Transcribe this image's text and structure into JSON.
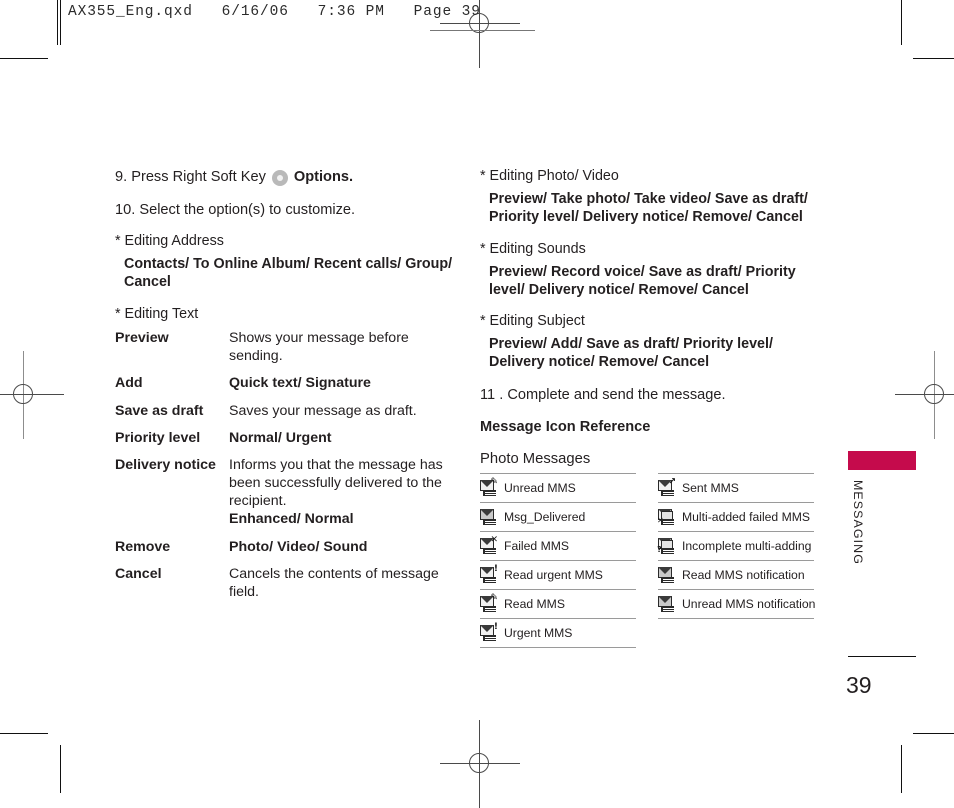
{
  "print_marks": {
    "slug": "AX355_Eng.qxd   6/16/06   7:36 PM   Page 39"
  },
  "left_column": {
    "steps": [
      {
        "prefix": "9. Press Right Soft Key",
        "icon": "soft-key-round-icon",
        "suffix": "Options.",
        "suffix_bold": true
      },
      {
        "prefix": "10. Select the option(s) to customize.",
        "icon": null,
        "suffix": "",
        "suffix_bold": false
      }
    ],
    "editing_address": {
      "heading": "* Editing Address",
      "options": "Contacts/ To Online Album/ Recent calls/ Group/ Cancel"
    },
    "editing_text": {
      "heading": "* Editing Text",
      "rows": [
        {
          "term": "Preview",
          "desc": "Shows your message before sending.",
          "bold": false,
          "extra": ""
        },
        {
          "term": "Add",
          "desc": "Quick text/ Signature",
          "bold": true,
          "extra": ""
        },
        {
          "term": "Save as draft",
          "desc": "Saves your message as draft.",
          "bold": false,
          "extra": ""
        },
        {
          "term": "Priority level",
          "desc": "Normal/ Urgent",
          "bold": true,
          "extra": ""
        },
        {
          "term": "Delivery notice",
          "desc": "Informs you that the message has been successfully delivered to the recipient.",
          "bold": false,
          "extra": "Enhanced/ Normal"
        },
        {
          "term": "Remove",
          "desc": "Photo/ Video/ Sound",
          "bold": true,
          "extra": ""
        },
        {
          "term": "Cancel",
          "desc": "Cancels the contents of message field.",
          "bold": false,
          "extra": ""
        }
      ]
    }
  },
  "right_column": {
    "sections": [
      {
        "heading": "* Editing Photo/ Video",
        "options": "Preview/ Take photo/ Take video/ Save as draft/ Priority level/ Delivery notice/ Remove/ Cancel"
      },
      {
        "heading": "* Editing Sounds",
        "options": "Preview/ Record voice/ Save as draft/ Priority level/ Delivery notice/ Remove/ Cancel"
      },
      {
        "heading": "* Editing Subject",
        "options": "Preview/ Add/ Save as draft/ Priority level/ Delivery notice/ Remove/ Cancel"
      }
    ],
    "step11": "11 . Complete and send the message.",
    "reference_title": "Message Icon Reference",
    "photo_messages_title": "Photo Messages",
    "icon_table": {
      "left": [
        {
          "icon": "unread-mms-icon",
          "label": "Unread MMS",
          "variant": "badge",
          "badge": "✎"
        },
        {
          "icon": "msg-delivered-icon",
          "label": "Msg_Delivered",
          "variant": "shaded",
          "badge": ""
        },
        {
          "icon": "failed-mms-icon",
          "label": "Failed MMS",
          "variant": "badge",
          "badge": "✕"
        },
        {
          "icon": "read-urgent-mms-icon",
          "label": "Read urgent MMS",
          "variant": "badge",
          "badge": "!"
        },
        {
          "icon": "read-mms-icon",
          "label": "Read MMS",
          "variant": "badge",
          "badge": "✎"
        },
        {
          "icon": "urgent-mms-icon",
          "label": "Urgent MMS",
          "variant": "badge",
          "badge": "!"
        }
      ],
      "right": [
        {
          "icon": "sent-mms-icon",
          "label": "Sent MMS",
          "variant": "badge",
          "badge": "↗"
        },
        {
          "icon": "multi-added-failed-mms-icon",
          "label": "Multi-added failed MMS",
          "variant": "double",
          "badge": "✕"
        },
        {
          "icon": "incomplete-multi-adding-icon",
          "label": "Incomplete multi-adding",
          "variant": "double",
          "badge": "?"
        },
        {
          "icon": "read-mms-notification-icon",
          "label": "Read MMS notification",
          "variant": "shaded",
          "badge": ""
        },
        {
          "icon": "unread-mms-notification-icon",
          "label": "Unread MMS notification",
          "variant": "shaded",
          "badge": ""
        }
      ]
    }
  },
  "sidebar": {
    "tab_color": "#c50b4c",
    "section_label": "MESSAGING",
    "page_number": "39"
  }
}
